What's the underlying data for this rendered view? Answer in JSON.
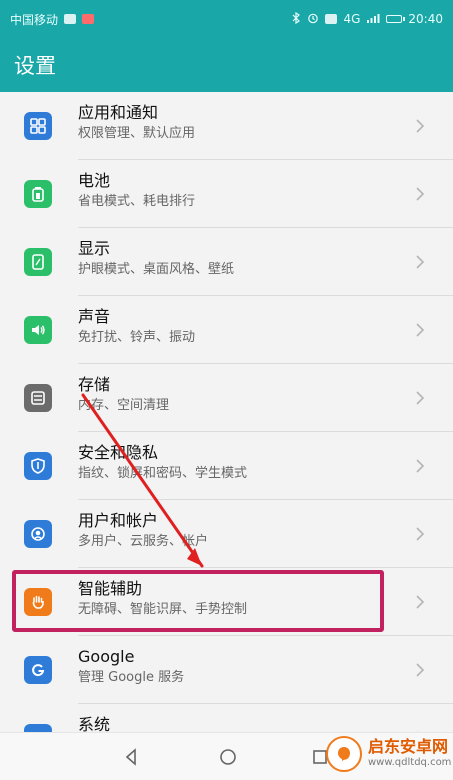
{
  "status": {
    "carrier": "中国移动",
    "network": "4G",
    "time": "20:40"
  },
  "header": {
    "title": "设置"
  },
  "items": [
    {
      "title": "应用和通知",
      "subtitle": "权限管理、默认应用",
      "icon": "apps-icon",
      "color": "#2f7bd8"
    },
    {
      "title": "电池",
      "subtitle": "省电模式、耗电排行",
      "icon": "battery-icon",
      "color": "#2bbf6a"
    },
    {
      "title": "显示",
      "subtitle": "护眼模式、桌面风格、壁纸",
      "icon": "display-icon",
      "color": "#2bbf6a"
    },
    {
      "title": "声音",
      "subtitle": "免打扰、铃声、振动",
      "icon": "sound-icon",
      "color": "#2bbf6a"
    },
    {
      "title": "存储",
      "subtitle": "内存、空间清理",
      "icon": "storage-icon",
      "color": "#6b6b6b"
    },
    {
      "title": "安全和隐私",
      "subtitle": "指纹、锁屏和密码、学生模式",
      "icon": "shield-icon",
      "color": "#2f7bd8"
    },
    {
      "title": "用户和帐户",
      "subtitle": "多用户、云服务、帐户",
      "icon": "user-icon",
      "color": "#2f7bd8"
    },
    {
      "title": "智能辅助",
      "subtitle": "无障碍、智能识屏、手势控制",
      "icon": "hand-icon",
      "color": "#f07b1a"
    },
    {
      "title": "Google",
      "subtitle": "管理 Google 服务",
      "icon": "google-icon",
      "color": "#2f7bd8"
    },
    {
      "title": "系统",
      "subtitle": "",
      "icon": "system-icon",
      "color": "#2f7bd8"
    }
  ],
  "highlight": {
    "color": "#c2215f"
  },
  "annotation": {
    "arrow_color": "#e02020"
  },
  "navbar": {
    "back_icon": "back-icon",
    "home_icon": "home-icon",
    "recents_icon": "recents-icon"
  },
  "watermark": {
    "title": "启东安卓网",
    "url": "www.qdltdq.com"
  }
}
